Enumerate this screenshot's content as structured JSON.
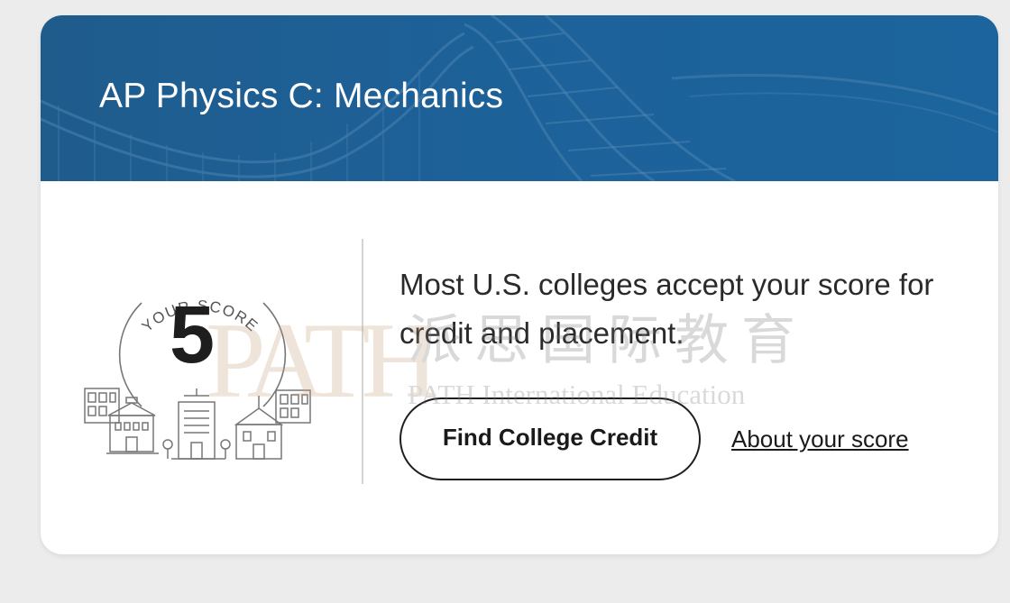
{
  "card": {
    "title": "AP Physics C: Mechanics",
    "banner_color": "#1d6199",
    "score": {
      "label": "YOUR SCORE",
      "value": "5",
      "illustration": "college-buildings-icon"
    },
    "message": "Most U.S. colleges accept your score for credit and placement.",
    "primary_button_label": "Find College Credit",
    "secondary_link_label": "About your score"
  },
  "watermark": {
    "logo_text": "PATH",
    "chinese_text": "派思国际教育",
    "english_text": "PATH International Education"
  }
}
